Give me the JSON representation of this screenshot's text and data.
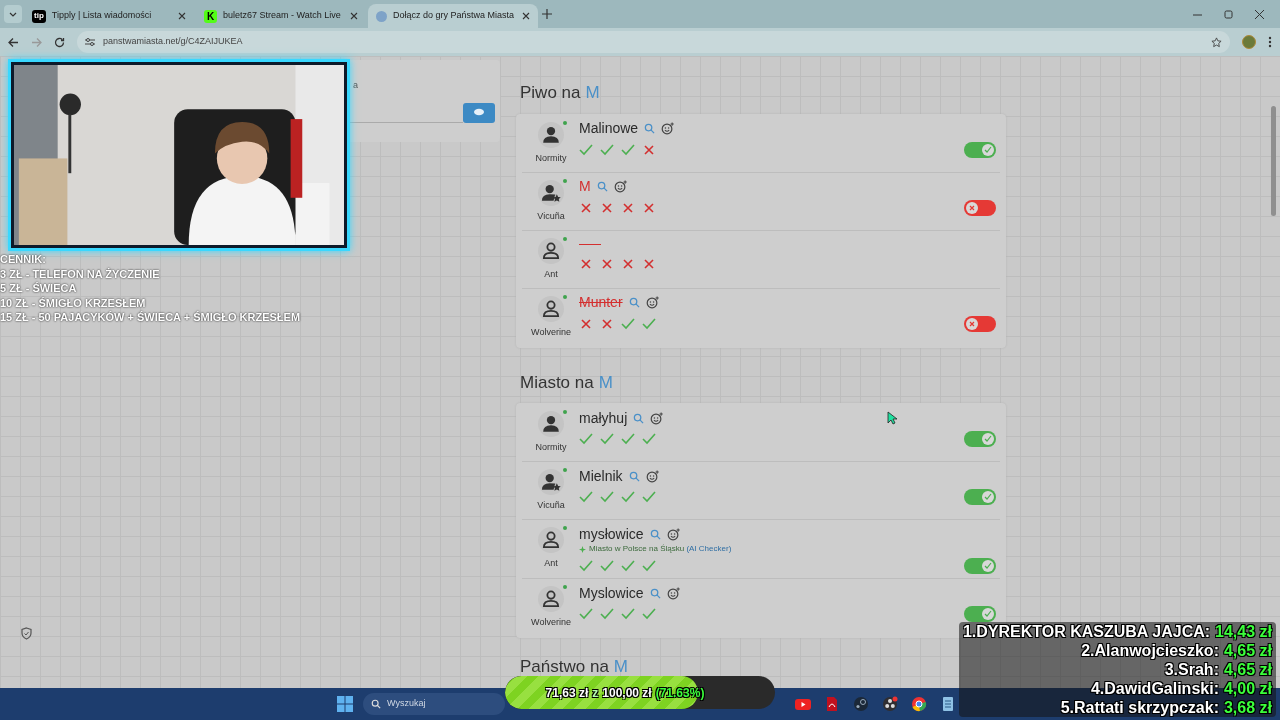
{
  "browser": {
    "tabs": [
      {
        "title": "Tipply | Lista wiadomości",
        "favicon": "tip",
        "selected": false
      },
      {
        "title": "buletz67 Stream - Watch Live",
        "favicon": "K",
        "selected": false
      },
      {
        "title": "Dołącz do gry Państwa Miasta",
        "selected": true
      }
    ],
    "url": "panstwamiasta.net/g/C4ZAIJUKEA"
  },
  "side_panel": {
    "label": "a"
  },
  "sections": [
    {
      "title": "Piwo na",
      "letter": "M",
      "answers": [
        {
          "player": "Normity",
          "kind": "solid",
          "text": "Malinowe",
          "rejected": false,
          "struck": false,
          "checks": [
            true,
            true,
            true,
            false
          ],
          "accepted": true
        },
        {
          "player": "Vicuña",
          "kind": "star",
          "text": "M",
          "rejected": true,
          "struck": false,
          "checks": [
            false,
            false,
            false,
            false
          ],
          "accepted": false
        },
        {
          "player": "Ant",
          "kind": "outline",
          "checks": [
            false,
            false,
            false,
            false
          ]
        },
        {
          "player": "Wolverine",
          "kind": "outline",
          "text": "Munter",
          "rejected": true,
          "struck": true,
          "checks": [
            false,
            false,
            true,
            true
          ],
          "accepted": false
        }
      ]
    },
    {
      "title": "Miasto na",
      "letter": "M",
      "answers": [
        {
          "player": "Normity",
          "kind": "solid",
          "text": "małyhuj",
          "rejected": false,
          "struck": false,
          "checks": [
            true,
            true,
            true,
            true
          ],
          "accepted": true
        },
        {
          "player": "Vicuña",
          "kind": "star",
          "text": "Mielnik",
          "rejected": false,
          "struck": false,
          "checks": [
            true,
            true,
            true,
            true
          ],
          "accepted": true
        },
        {
          "player": "Ant",
          "kind": "outline",
          "text": "mysłowice",
          "note": "Miasto w Polsce na Śląsku",
          "note_source": "(AI Checker)",
          "rejected": false,
          "struck": false,
          "checks": [
            true,
            true,
            true,
            true
          ],
          "accepted": true
        },
        {
          "player": "Wolverine",
          "kind": "outline",
          "text": "Myslowice",
          "rejected": false,
          "struck": false,
          "checks": [
            true,
            true,
            true,
            true
          ],
          "accepted": true
        }
      ]
    },
    {
      "title": "Państwo na",
      "letter": "M"
    }
  ],
  "price_list": {
    "title": "CENNIK:",
    "lines": [
      "3 ZŁ - TELEFON NA ŻYCZENIE",
      "5 ZŁ - ŚWIECA",
      "10 ZŁ - ŚMIGŁO KRZESŁEM",
      "15 ZŁ - 50 PAJACYKÓW + ŚWIECA + ŚMIGŁO KRZESŁEM"
    ]
  },
  "leaderboard": [
    {
      "name": "1.DYREKTOR KASZUBA JAJCA:",
      "amount": "14,43 zł"
    },
    {
      "name": "2.Alanwojcieszko:",
      "amount": "4,65 zł"
    },
    {
      "name": "3.Srah:",
      "amount": "4,65 zł"
    },
    {
      "name": "4.DawidGalinski:",
      "amount": "4,00 zł"
    },
    {
      "name": "5.Rattati skrzypczak:",
      "amount": "3,68 zł"
    }
  ],
  "goal": {
    "raised": "71,63 zł",
    "separator": "z",
    "target": "100,00 zł",
    "percent": "(71.63%)",
    "level": 0.7163
  },
  "taskbar": {
    "search_placeholder": "Wyszukaj"
  }
}
